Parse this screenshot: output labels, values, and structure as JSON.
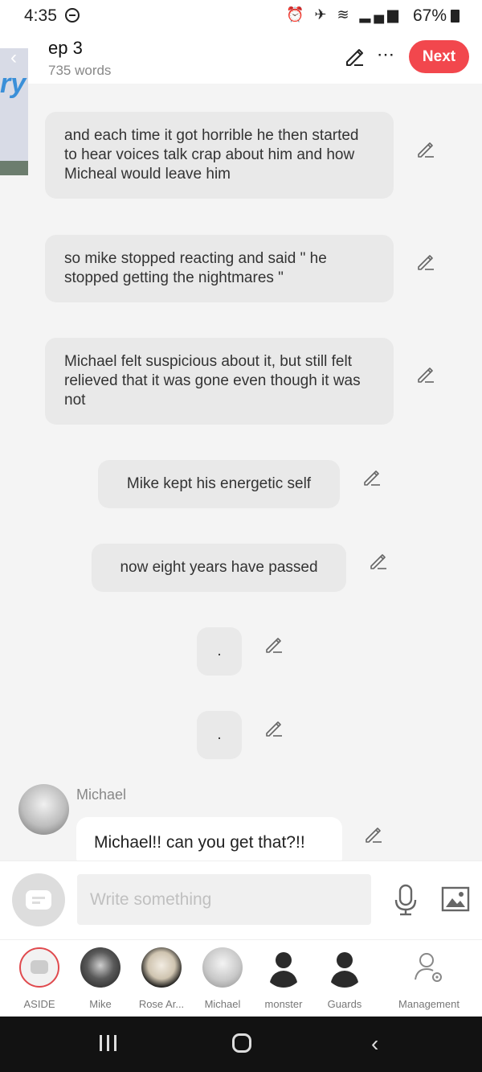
{
  "status_bar": {
    "time": "4:35",
    "battery_text": "67%"
  },
  "header": {
    "title": "ep 3",
    "word_count": "735 words",
    "next_label": "Next",
    "more_glyph": "⋯"
  },
  "messages": [
    {
      "text": "and each time it got horrible he then started to hear voices talk crap about him and how Micheal would leave him"
    },
    {
      "text": "so mike stopped reacting and said \" he stopped getting the nightmares \""
    },
    {
      "text": "Michael felt suspicious about it, but still felt relieved that it was gone even though it was not"
    },
    {
      "text": "Mike kept his energetic self"
    },
    {
      "text": "now eight years have passed"
    },
    {
      "text": "."
    },
    {
      "text": "."
    }
  ],
  "dialogue": {
    "speaker": "Michael",
    "text": "Michael!! can you get that?!!"
  },
  "composer": {
    "placeholder": "Write something"
  },
  "characters": [
    {
      "name": "ASIDE"
    },
    {
      "name": "Mike"
    },
    {
      "name": "Rose Ar..."
    },
    {
      "name": "Michael"
    },
    {
      "name": "monster"
    },
    {
      "name": "Guards"
    },
    {
      "name": "Management"
    }
  ],
  "colors": {
    "accent": "#f2474d",
    "bubble": "#e9e9e9",
    "background": "#f4f4f4"
  },
  "icons": [
    "pencil-icon",
    "more-icon",
    "aside-icon",
    "mic-icon",
    "image-icon",
    "management-icon",
    "back-icon",
    "home-icon",
    "recents-icon"
  ]
}
